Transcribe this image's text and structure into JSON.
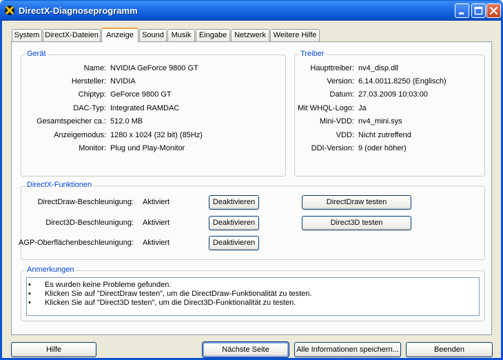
{
  "window": {
    "title": "DirectX-Diagnoseprogramm"
  },
  "tabs": [
    {
      "label": "System"
    },
    {
      "label": "DirectX-Dateien"
    },
    {
      "label": "Anzeige"
    },
    {
      "label": "Sound"
    },
    {
      "label": "Musik"
    },
    {
      "label": "Eingabe"
    },
    {
      "label": "Netzwerk"
    },
    {
      "label": "Weitere Hilfe"
    }
  ],
  "device": {
    "title": "Gerät",
    "rows": [
      {
        "label": "Name:",
        "value": "NVIDIA GeForce 9800 GT"
      },
      {
        "label": "Hersteller:",
        "value": "NVIDIA"
      },
      {
        "label": "Chiptyp:",
        "value": "GeForce 9800 GT"
      },
      {
        "label": "DAC-Typ:",
        "value": "Integrated RAMDAC"
      },
      {
        "label": "Gesamtspeicher ca.:",
        "value": "512.0 MB"
      },
      {
        "label": "Anzeigemodus:",
        "value": "1280 x 1024 (32 bit) (85Hz)"
      },
      {
        "label": "Monitor:",
        "value": "Plug und Play-Monitor"
      }
    ]
  },
  "driver": {
    "title": "Treiber",
    "rows": [
      {
        "label": "Haupttreiber:",
        "value": "nv4_disp.dll"
      },
      {
        "label": "Version:",
        "value": "6.14.0011.8250 (Englisch)"
      },
      {
        "label": "Datum:",
        "value": "27.03.2009 10:03:00"
      },
      {
        "label": "Mit WHQL-Logo:",
        "value": "Ja"
      },
      {
        "label": "Mini-VDD:",
        "value": "nv4_mini.sys"
      },
      {
        "label": "VDD:",
        "value": "Nicht zutreffend"
      },
      {
        "label": "DDI-Version:",
        "value": "9 (oder höher)"
      }
    ]
  },
  "features": {
    "title": "DirectX-Funktionen",
    "rows": [
      {
        "label": "DirectDraw-Beschleunigung:",
        "status": "Aktiviert",
        "toggle": "Deaktivieren",
        "test": "DirectDraw testen"
      },
      {
        "label": "Direct3D-Beschleunigung:",
        "status": "Aktiviert",
        "toggle": "Deaktivieren",
        "test": "Direct3D testen"
      },
      {
        "label": "AGP-Oberflächenbeschleunigung:",
        "status": "Aktiviert",
        "toggle": "Deaktivieren"
      }
    ]
  },
  "notes": {
    "title": "Anmerkungen",
    "bullet": "•",
    "items": [
      "Es wurden keine Probleme gefunden.",
      "Klicken Sie auf \"DirectDraw testen\", um die DirectDraw-Funktionalität zu testen.",
      "Klicken Sie auf \"Direct3D testen\", um die Direct3D-Funktionalität zu testen."
    ]
  },
  "footer": {
    "help": "Hilfe",
    "next": "Nächste Seite",
    "save_all": "Alle Informationen speichern...",
    "exit": "Beenden"
  }
}
